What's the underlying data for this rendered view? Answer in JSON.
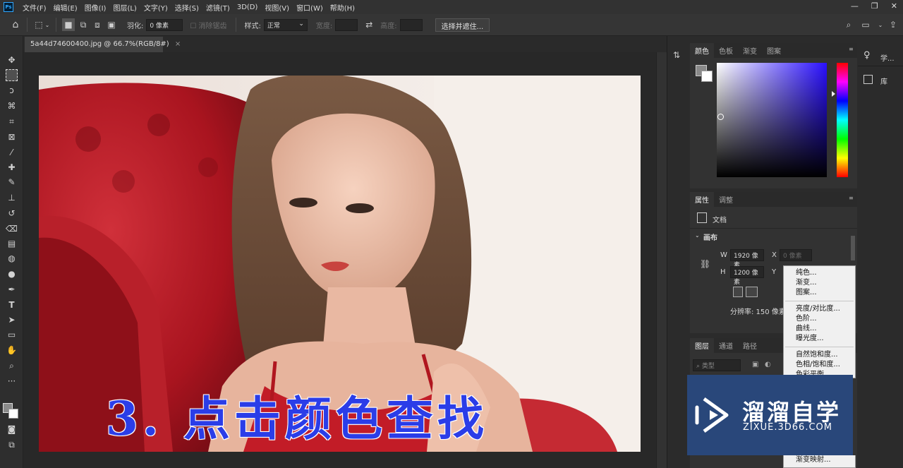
{
  "app": {
    "logo": "Ps"
  },
  "menu": [
    "文件(F)",
    "编辑(E)",
    "图像(I)",
    "图层(L)",
    "文字(Y)",
    "选择(S)",
    "滤镜(T)",
    "3D(D)",
    "视图(V)",
    "窗口(W)",
    "帮助(H)"
  ],
  "window_controls": {
    "minimize": "—",
    "restore": "❐",
    "close": "✕"
  },
  "options": {
    "feather_label": "羽化:",
    "feather_value": "0 像素",
    "antialias_label": "消除锯齿",
    "style_label": "样式:",
    "style_value": "正常",
    "width_label": "宽度:",
    "height_label": "高度:",
    "select_mask_button": "选择并遮住..."
  },
  "document": {
    "tab_title": "5a44d74600400.jpg @ 66.7%(RGB/8#)",
    "tab_close": "×"
  },
  "caption": "3. 点击颜色查找",
  "color_panel": {
    "tabs": [
      "颜色",
      "色板",
      "渐变",
      "图案"
    ]
  },
  "properties_panel": {
    "tabs": [
      "属性",
      "调整"
    ],
    "doc_label": "文档",
    "section": "画布",
    "w_label": "W",
    "w_value": "1920 像素",
    "x_label": "X",
    "x_value": "0 像素",
    "h_label": "H",
    "h_value": "1200 像素",
    "y_label": "Y",
    "resolution": "分辨率: 150 像素"
  },
  "layers_panel": {
    "tabs": [
      "图层",
      "通道",
      "路径"
    ],
    "filter_placeholder": "类型"
  },
  "adjust_menu": {
    "group1": [
      "纯色...",
      "渐变...",
      "图案..."
    ],
    "group2": [
      "亮度/对比度...",
      "色阶...",
      "曲线...",
      "曝光度..."
    ],
    "group3": [
      "自然饱和度...",
      "色相/饱和度...",
      "色彩平衡..."
    ],
    "bottom": "渐变映射..."
  },
  "right_dock": {
    "learn": "学...",
    "library": "库"
  },
  "watermark": {
    "title": "溜溜自学",
    "url": "ZIXUE.3D66.COM"
  },
  "colors": {
    "accent_caption": "#2b3de8",
    "watermark_bg": "#29477a",
    "fg_swatch": "#8a8a8a",
    "bg_swatch": "#ffffff"
  }
}
